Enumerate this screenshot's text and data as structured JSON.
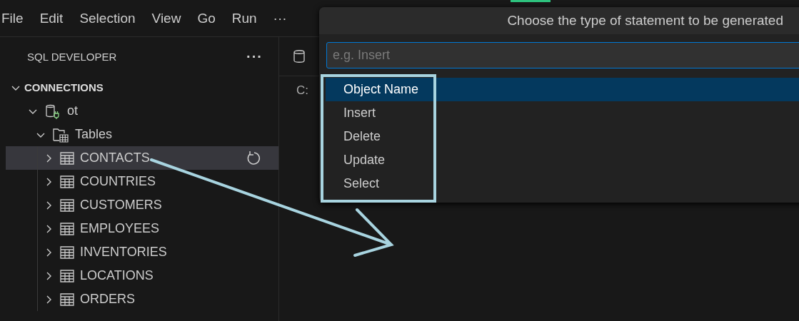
{
  "menu": [
    "File",
    "Edit",
    "Selection",
    "View",
    "Go",
    "Run",
    "···"
  ],
  "sidebar": {
    "title": "SQL DEVELOPER",
    "more": "···",
    "section": {
      "label": "CONNECTIONS",
      "expanded": true
    },
    "tree": [
      {
        "label": "ot",
        "kind": "connection",
        "expanded": true,
        "selected": false,
        "children": [
          {
            "label": "Tables",
            "kind": "folder",
            "expanded": true,
            "selected": false,
            "children": [
              {
                "label": "CONTACTS",
                "kind": "table",
                "expanded": false,
                "selected": true
              },
              {
                "label": "COUNTRIES",
                "kind": "table",
                "expanded": false,
                "selected": false
              },
              {
                "label": "CUSTOMERS",
                "kind": "table",
                "expanded": false,
                "selected": false
              },
              {
                "label": "EMPLOYEES",
                "kind": "table",
                "expanded": false,
                "selected": false
              },
              {
                "label": "INVENTORIES",
                "kind": "table",
                "expanded": false,
                "selected": false
              },
              {
                "label": "LOCATIONS",
                "kind": "table",
                "expanded": false,
                "selected": false
              },
              {
                "label": "ORDERS",
                "kind": "table",
                "expanded": false,
                "selected": false
              }
            ]
          }
        ]
      }
    ]
  },
  "editor": {
    "breadcrumb": "C:"
  },
  "quick_pick": {
    "title": "Choose the type of statement to be generated",
    "placeholder": "e.g. Insert",
    "items": [
      {
        "label": "Object Name",
        "selected": true
      },
      {
        "label": "Insert",
        "selected": false
      },
      {
        "label": "Delete",
        "selected": false
      },
      {
        "label": "Update",
        "selected": false
      },
      {
        "label": "Select",
        "selected": false
      }
    ]
  }
}
